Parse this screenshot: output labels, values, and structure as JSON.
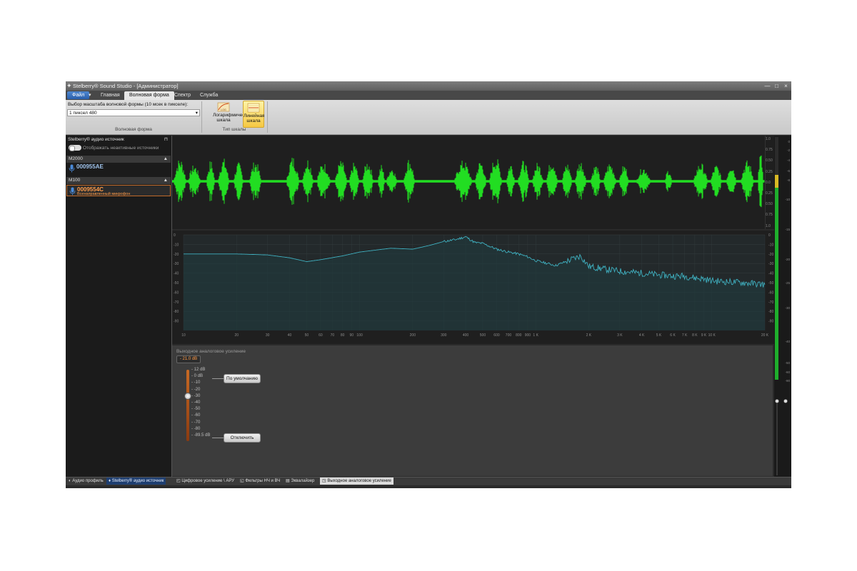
{
  "window": {
    "title": "Stelberry® Sound Studio - [Администратор]",
    "minimize": "—",
    "maximize": "□",
    "close": "×"
  },
  "menu": {
    "file": "Файл",
    "home": "Главная",
    "waveform": "Волновая форма",
    "spectrum": "Спектр",
    "service": "Служба"
  },
  "ribbon": {
    "scale_label": "Выбор масштаба волновой формы (10 мсек в пикселе):",
    "scale_value": "1 пиксел 480",
    "group_waveform": "Волновая форма",
    "log_scale": [
      "Логарифмическая",
      "шкала"
    ],
    "linear_scale": [
      "Линейная",
      "шкала"
    ],
    "group_scale_type": "Тип шкалы",
    "icon_label": "LOG"
  },
  "leftpanel": {
    "title": "Stelberry® аудио источник",
    "pin": "⊓",
    "show_inactive": "Отображать неактивные источники",
    "group1": "M2000",
    "device1": "000955AE",
    "group2": "M100",
    "device2": "0009554C",
    "device2_sub": "Всенаправленный микрофон",
    "collapse": "▲"
  },
  "wave_scale": [
    "1.0",
    "0.75",
    "0.50",
    "0.25",
    "0.0",
    "0.25",
    "0.50",
    "0.75",
    "1.0"
  ],
  "meter_scale": [
    "0",
    "-2",
    "-4",
    "-6",
    "-8",
    "-10",
    "-15",
    "-20",
    "-25",
    "-30",
    "-40",
    "-50",
    "-60",
    "-90"
  ],
  "chart_data": {
    "type": "line",
    "x_axis_labels": [
      "10",
      "20",
      "30",
      "40",
      "50",
      "60",
      "70",
      "80",
      "90",
      "100",
      "200",
      "300",
      "400",
      "500",
      "600",
      "700",
      "800",
      "900",
      "1 K",
      "2 K",
      "3 K",
      "4 K",
      "5 K",
      "6 K",
      "7 K",
      "8 K",
      "9 K",
      "10 K",
      "20 K"
    ],
    "y_axis_labels": [
      "0",
      "-10",
      "-20",
      "-30",
      "-40",
      "-50",
      "-60",
      "-70",
      "-80",
      "-90"
    ],
    "ylim": [
      -100,
      0
    ],
    "xlim": [
      10,
      20000
    ],
    "x_scale": "log",
    "series": [
      {
        "color": "#3fb0c0",
        "points": [
          [
            10,
            -20
          ],
          [
            20,
            -20
          ],
          [
            30,
            -21
          ],
          [
            40,
            -24
          ],
          [
            50,
            -28
          ],
          [
            60,
            -26
          ],
          [
            80,
            -22
          ],
          [
            100,
            -18
          ],
          [
            150,
            -14
          ],
          [
            200,
            -15
          ],
          [
            250,
            -11
          ],
          [
            300,
            -7
          ],
          [
            350,
            -5
          ],
          [
            400,
            -2
          ],
          [
            450,
            -8
          ],
          [
            500,
            -9
          ],
          [
            600,
            -15
          ],
          [
            700,
            -18
          ],
          [
            800,
            -20
          ],
          [
            900,
            -23
          ],
          [
            1000,
            -27
          ],
          [
            1300,
            -32
          ],
          [
            1800,
            -22
          ],
          [
            2000,
            -33
          ],
          [
            2500,
            -36
          ],
          [
            3000,
            -38
          ],
          [
            4000,
            -40
          ],
          [
            5000,
            -42
          ],
          [
            6000,
            -43
          ],
          [
            7000,
            -43
          ],
          [
            8000,
            -45
          ],
          [
            9000,
            -46
          ],
          [
            10000,
            -48
          ],
          [
            15000,
            -50
          ],
          [
            20000,
            -52
          ]
        ]
      }
    ]
  },
  "gain": {
    "title": "Выходное аналоговое усиление",
    "value": "- 21.0 dB",
    "scale": [
      "- 12 dB",
      "- 0 dB",
      "- -10",
      "- -20",
      "- -30",
      "- -40",
      "- -50",
      "- -60",
      "- -70",
      "- -80",
      "- -89.5 dB"
    ],
    "default_button": "По умолчанию",
    "disable_button": "Отключить",
    "level_fraction": 0.37
  },
  "bottom": {
    "left_tab1": "Аудио профиль",
    "left_tab2": "Stelberry® аудио источник",
    "tab1": "Цифровое усиление \\ АРУ",
    "tab2": "Фильтры НЧ и ВЧ",
    "tab3": "Эквалайзер",
    "tab4": "Выходное аналоговое усиление"
  },
  "colors": {
    "wave": "#22dd22",
    "spectrum": "#3fb0c0",
    "accent_orange": "#ff9c4a",
    "file_tab": "#3a70bd"
  }
}
